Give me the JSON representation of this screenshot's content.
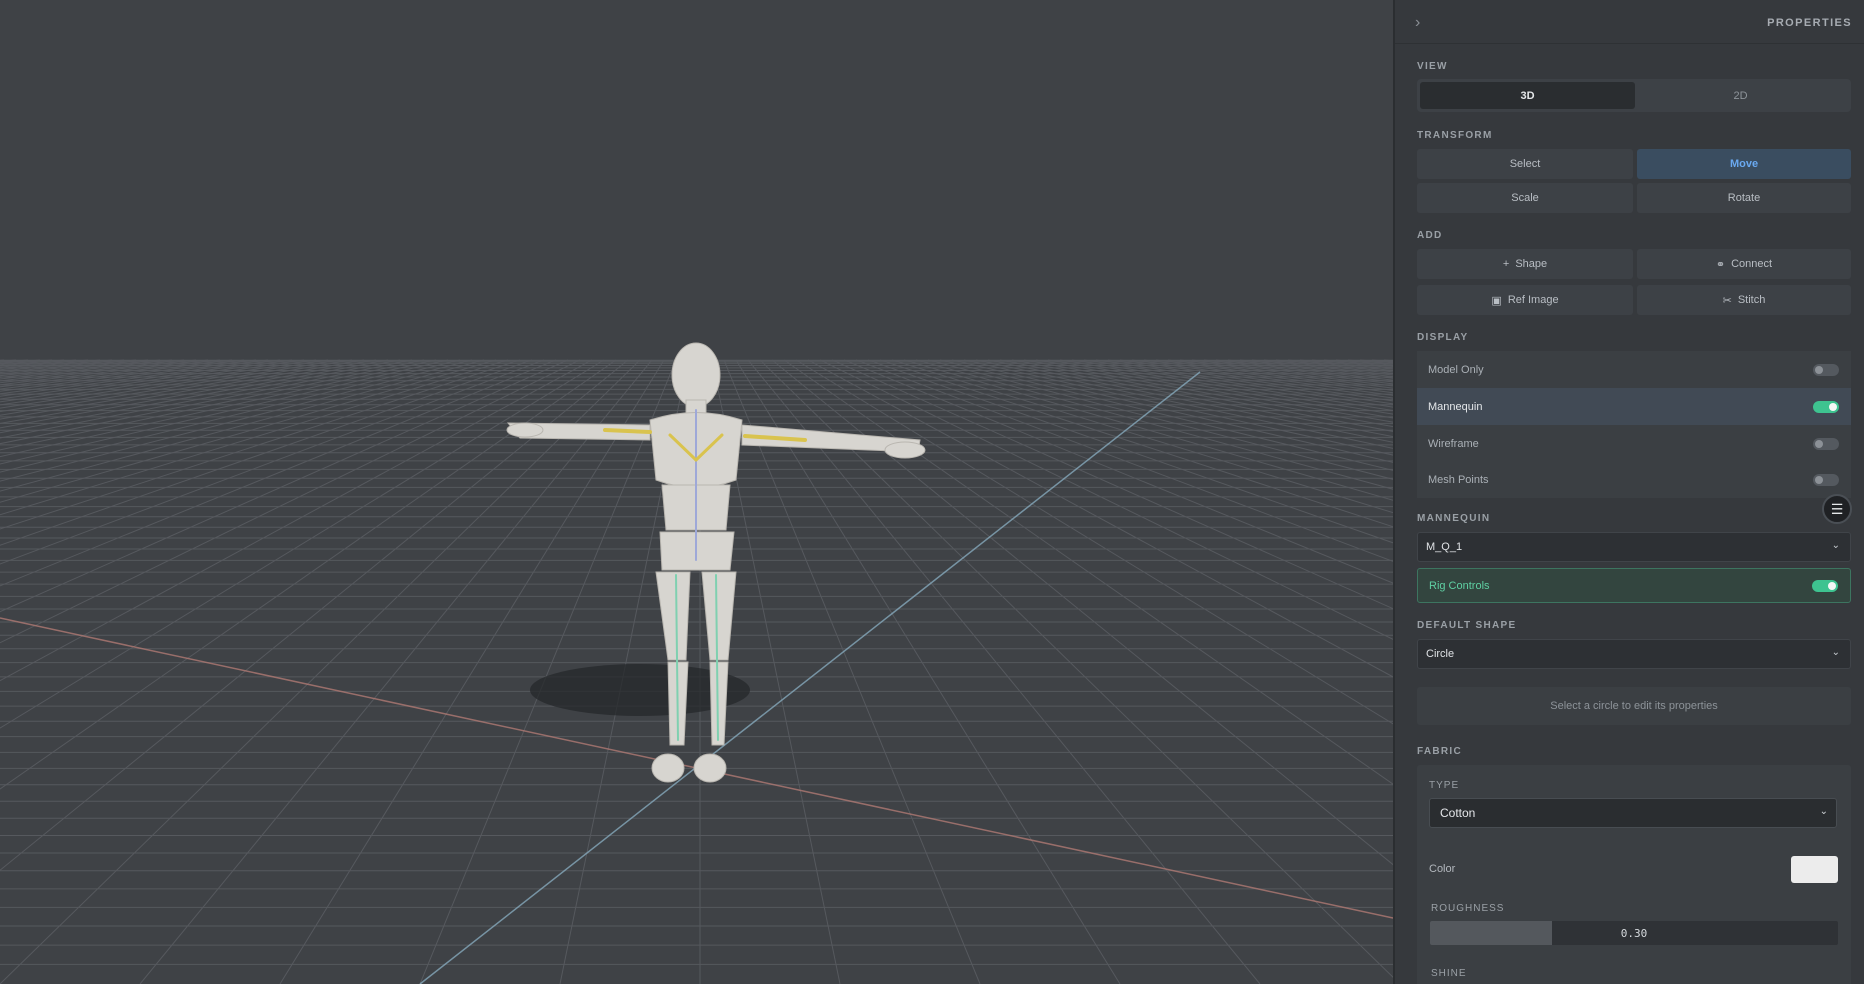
{
  "panel": {
    "title": "PROPERTIES",
    "view": {
      "label": "VIEW",
      "options": [
        "3D",
        "2D"
      ],
      "selected": "3D"
    },
    "transform": {
      "label": "TRANSFORM",
      "select": "Select",
      "move": "Move",
      "scale": "Scale",
      "rotate": "Rotate",
      "active": "Move"
    },
    "add": {
      "label": "ADD",
      "shape": "Shape",
      "connect": "Connect",
      "ref_image": "Ref Image",
      "stitch": "Stitch"
    },
    "display": {
      "label": "DISPLAY",
      "items": [
        {
          "label": "Model Only",
          "on": false
        },
        {
          "label": "Mannequin",
          "on": true
        },
        {
          "label": "Wireframe",
          "on": false
        },
        {
          "label": "Mesh Points",
          "on": false
        }
      ]
    },
    "mannequin": {
      "label": "MANNEQUIN",
      "value": "M_Q_1",
      "rig_controls": "Rig Controls",
      "rig_on": true
    },
    "default_shape": {
      "label": "DEFAULT SHAPE",
      "value": "Circle",
      "hint": "Select a circle to edit its properties"
    },
    "fabric": {
      "label": "FABRIC",
      "type_label": "TYPE",
      "type_value": "Cotton",
      "color_label": "Color",
      "color_value": "#ececec",
      "roughness_label": "ROUGHNESS",
      "roughness_value": "0.30",
      "roughness": 0.3,
      "shine_label": "SHINE"
    }
  },
  "colors": {
    "accent_move": "#6aa9f0",
    "toggle_on": "#3ec390",
    "rig_text": "#5fd0a3"
  },
  "icons": {
    "collapse": "chevron-right-icon",
    "shape": "plus-icon",
    "connect": "link-icon",
    "ref_image": "image-icon",
    "stitch": "scissors-icon",
    "floating": "sliders-icon"
  }
}
